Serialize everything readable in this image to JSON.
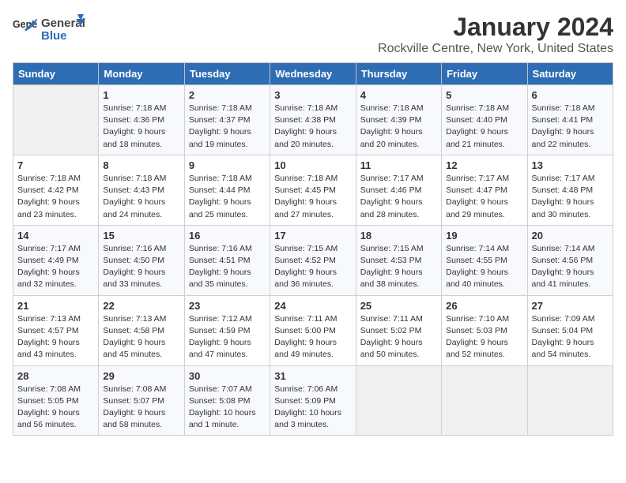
{
  "header": {
    "logo_general": "General",
    "logo_blue": "Blue",
    "month_title": "January 2024",
    "location": "Rockville Centre, New York, United States"
  },
  "days_of_week": [
    "Sunday",
    "Monday",
    "Tuesday",
    "Wednesday",
    "Thursday",
    "Friday",
    "Saturday"
  ],
  "weeks": [
    [
      {
        "day": "",
        "info": ""
      },
      {
        "day": "1",
        "info": "Sunrise: 7:18 AM\nSunset: 4:36 PM\nDaylight: 9 hours\nand 18 minutes."
      },
      {
        "day": "2",
        "info": "Sunrise: 7:18 AM\nSunset: 4:37 PM\nDaylight: 9 hours\nand 19 minutes."
      },
      {
        "day": "3",
        "info": "Sunrise: 7:18 AM\nSunset: 4:38 PM\nDaylight: 9 hours\nand 20 minutes."
      },
      {
        "day": "4",
        "info": "Sunrise: 7:18 AM\nSunset: 4:39 PM\nDaylight: 9 hours\nand 20 minutes."
      },
      {
        "day": "5",
        "info": "Sunrise: 7:18 AM\nSunset: 4:40 PM\nDaylight: 9 hours\nand 21 minutes."
      },
      {
        "day": "6",
        "info": "Sunrise: 7:18 AM\nSunset: 4:41 PM\nDaylight: 9 hours\nand 22 minutes."
      }
    ],
    [
      {
        "day": "7",
        "info": "Sunrise: 7:18 AM\nSunset: 4:42 PM\nDaylight: 9 hours\nand 23 minutes."
      },
      {
        "day": "8",
        "info": "Sunrise: 7:18 AM\nSunset: 4:43 PM\nDaylight: 9 hours\nand 24 minutes."
      },
      {
        "day": "9",
        "info": "Sunrise: 7:18 AM\nSunset: 4:44 PM\nDaylight: 9 hours\nand 25 minutes."
      },
      {
        "day": "10",
        "info": "Sunrise: 7:18 AM\nSunset: 4:45 PM\nDaylight: 9 hours\nand 27 minutes."
      },
      {
        "day": "11",
        "info": "Sunrise: 7:17 AM\nSunset: 4:46 PM\nDaylight: 9 hours\nand 28 minutes."
      },
      {
        "day": "12",
        "info": "Sunrise: 7:17 AM\nSunset: 4:47 PM\nDaylight: 9 hours\nand 29 minutes."
      },
      {
        "day": "13",
        "info": "Sunrise: 7:17 AM\nSunset: 4:48 PM\nDaylight: 9 hours\nand 30 minutes."
      }
    ],
    [
      {
        "day": "14",
        "info": "Sunrise: 7:17 AM\nSunset: 4:49 PM\nDaylight: 9 hours\nand 32 minutes."
      },
      {
        "day": "15",
        "info": "Sunrise: 7:16 AM\nSunset: 4:50 PM\nDaylight: 9 hours\nand 33 minutes."
      },
      {
        "day": "16",
        "info": "Sunrise: 7:16 AM\nSunset: 4:51 PM\nDaylight: 9 hours\nand 35 minutes."
      },
      {
        "day": "17",
        "info": "Sunrise: 7:15 AM\nSunset: 4:52 PM\nDaylight: 9 hours\nand 36 minutes."
      },
      {
        "day": "18",
        "info": "Sunrise: 7:15 AM\nSunset: 4:53 PM\nDaylight: 9 hours\nand 38 minutes."
      },
      {
        "day": "19",
        "info": "Sunrise: 7:14 AM\nSunset: 4:55 PM\nDaylight: 9 hours\nand 40 minutes."
      },
      {
        "day": "20",
        "info": "Sunrise: 7:14 AM\nSunset: 4:56 PM\nDaylight: 9 hours\nand 41 minutes."
      }
    ],
    [
      {
        "day": "21",
        "info": "Sunrise: 7:13 AM\nSunset: 4:57 PM\nDaylight: 9 hours\nand 43 minutes."
      },
      {
        "day": "22",
        "info": "Sunrise: 7:13 AM\nSunset: 4:58 PM\nDaylight: 9 hours\nand 45 minutes."
      },
      {
        "day": "23",
        "info": "Sunrise: 7:12 AM\nSunset: 4:59 PM\nDaylight: 9 hours\nand 47 minutes."
      },
      {
        "day": "24",
        "info": "Sunrise: 7:11 AM\nSunset: 5:00 PM\nDaylight: 9 hours\nand 49 minutes."
      },
      {
        "day": "25",
        "info": "Sunrise: 7:11 AM\nSunset: 5:02 PM\nDaylight: 9 hours\nand 50 minutes."
      },
      {
        "day": "26",
        "info": "Sunrise: 7:10 AM\nSunset: 5:03 PM\nDaylight: 9 hours\nand 52 minutes."
      },
      {
        "day": "27",
        "info": "Sunrise: 7:09 AM\nSunset: 5:04 PM\nDaylight: 9 hours\nand 54 minutes."
      }
    ],
    [
      {
        "day": "28",
        "info": "Sunrise: 7:08 AM\nSunset: 5:05 PM\nDaylight: 9 hours\nand 56 minutes."
      },
      {
        "day": "29",
        "info": "Sunrise: 7:08 AM\nSunset: 5:07 PM\nDaylight: 9 hours\nand 58 minutes."
      },
      {
        "day": "30",
        "info": "Sunrise: 7:07 AM\nSunset: 5:08 PM\nDaylight: 10 hours\nand 1 minute."
      },
      {
        "day": "31",
        "info": "Sunrise: 7:06 AM\nSunset: 5:09 PM\nDaylight: 10 hours\nand 3 minutes."
      },
      {
        "day": "",
        "info": ""
      },
      {
        "day": "",
        "info": ""
      },
      {
        "day": "",
        "info": ""
      }
    ]
  ]
}
